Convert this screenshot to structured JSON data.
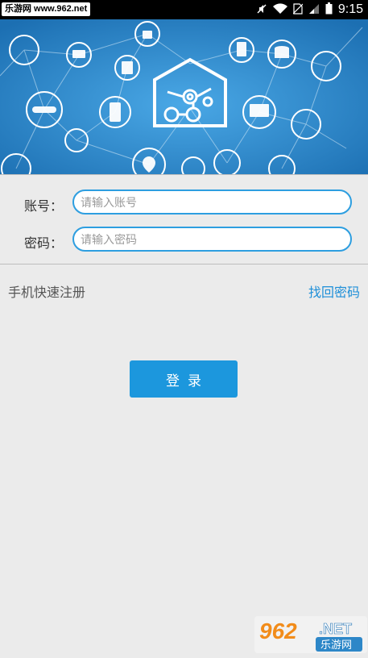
{
  "status_bar": {
    "watermark_text": "乐游网 www.962.net",
    "time": "9:15",
    "icons": [
      "mute-icon",
      "wifi-icon",
      "no-sim-icon",
      "signal-icon",
      "battery-icon"
    ]
  },
  "banner": {
    "theme": "smart-home",
    "background_color": "#2d87c8"
  },
  "form": {
    "account": {
      "label": "账号：",
      "placeholder": "请输入账号"
    },
    "password": {
      "label": "密码：",
      "placeholder": "请输入密码"
    }
  },
  "links": {
    "quick_register": "手机快速注册",
    "forgot_password": "找回密码"
  },
  "login_button": {
    "label": "登录"
  },
  "watermark": {
    "number": "962",
    "suffix": ".NET",
    "site": "乐游网"
  },
  "colors": {
    "accent": "#1c97dd",
    "background": "#ebebeb"
  }
}
